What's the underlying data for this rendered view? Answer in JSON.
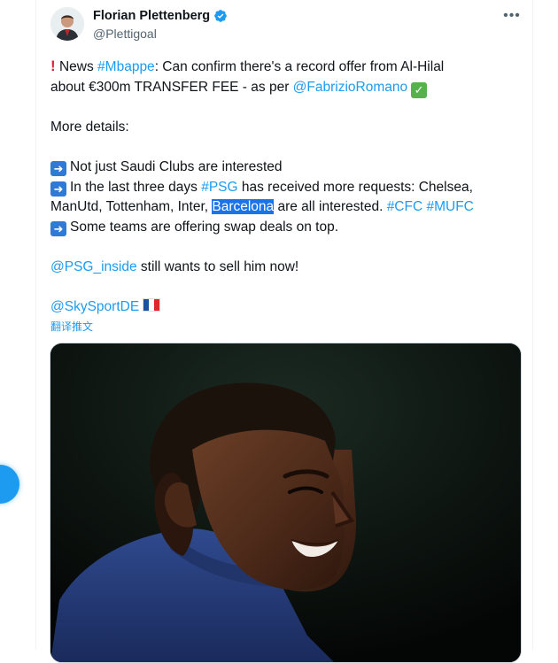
{
  "author": {
    "name": "Florian Plettenberg",
    "handle": "@Plettigoal",
    "verified": true
  },
  "tweet": {
    "line1": {
      "pre": " News ",
      "hashtag_mbappe": "#Mbappe",
      "rest": ": Can confirm there's a record offer from Al-Hilal"
    },
    "line2": {
      "pre": "about €300m TRANSFER FEE - as per ",
      "mention_fabrizio": "@FabrizioRomano"
    },
    "more_details": "More details:",
    "bullet1": "Not just Saudi Clubs are interested",
    "bullet2": {
      "pre": "In the last three days ",
      "hashtag_psg": "#PSG",
      "mid": " has received more requests: Chelsea,",
      "line2_pre": "ManUtd, Tottenham, Inter, ",
      "highlighted": "Barcelona",
      "line2_post": " are all interested. ",
      "hashtag_cfc": "#CFC",
      "hashtag_mufc": "#MUFC"
    },
    "bullet3": "Some teams are offering swap deals on top.",
    "psg_line": {
      "mention": "@PSG_inside",
      "rest": " still wants to sell him now!"
    },
    "skysport_mention": "@SkySportDE"
  },
  "translate_label": "翻译推文",
  "icons": {
    "more": "more-icon",
    "verified": "verified-badge-icon",
    "arrow": "right-arrow-emoji-icon",
    "check": "check-mark-emoji-icon",
    "flag": "france-flag-icon",
    "exclamation": "exclamation-emoji-icon"
  },
  "colors": {
    "link": "#1d9bf0",
    "text": "#0f1419",
    "secondary": "#536471",
    "highlight": "#1a73e8"
  }
}
